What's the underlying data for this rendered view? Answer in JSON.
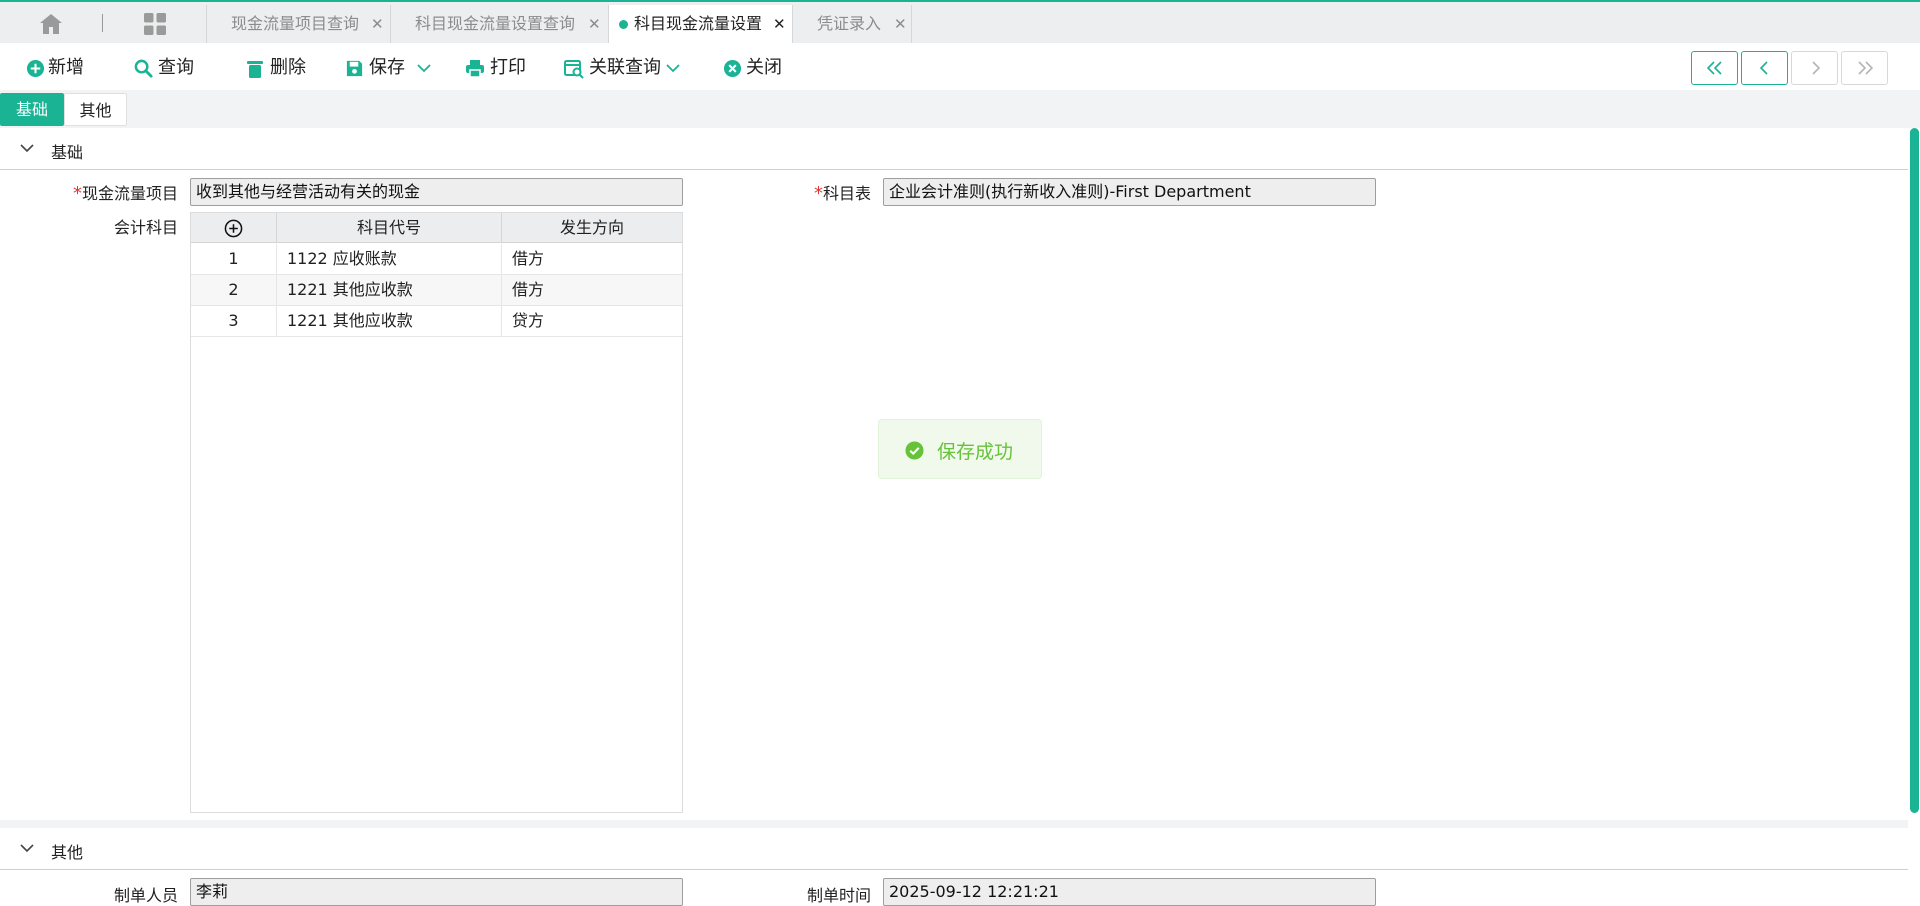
{
  "tabs": [
    {
      "label": "现金流量项目查询"
    },
    {
      "label": "科目现金流量设置查询"
    },
    {
      "label": "科目现金流量设置"
    },
    {
      "label": "凭证录入"
    }
  ],
  "toolbar": {
    "new_label": "新增",
    "query_label": "查询",
    "delete_label": "删除",
    "save_label": "保存",
    "print_label": "打印",
    "related_query_label": "关联查询",
    "close_label": "关闭"
  },
  "subtabs": {
    "basic": "基础",
    "other": "其他"
  },
  "basic_section": {
    "title": "基础",
    "cash_flow_item_label": "现金流量项目",
    "cash_flow_item_value": "收到其他与经营活动有关的现金",
    "account_table_label": "科目表",
    "account_table_value": "企业会计准则(执行新收入准则)-First Department",
    "accounts_label": "会计科目",
    "grid": {
      "col_code": "科目代号",
      "col_direction": "发生方向",
      "rows": [
        {
          "idx": "1",
          "code": "1122 应收账款",
          "direction": "借方"
        },
        {
          "idx": "2",
          "code": "1221 其他应收款",
          "direction": "借方"
        },
        {
          "idx": "3",
          "code": "1221 其他应收款",
          "direction": "贷方"
        }
      ]
    }
  },
  "other_section": {
    "title": "其他",
    "creator_label": "制单人员",
    "creator_value": "李莉",
    "create_time_label": "制单时间",
    "create_time_value": "2025-09-12 12:21:21"
  },
  "toast": {
    "message": "保存成功"
  },
  "colors": {
    "accent": "#1ab394",
    "required": "#e5322f",
    "success": "#67c23a"
  }
}
